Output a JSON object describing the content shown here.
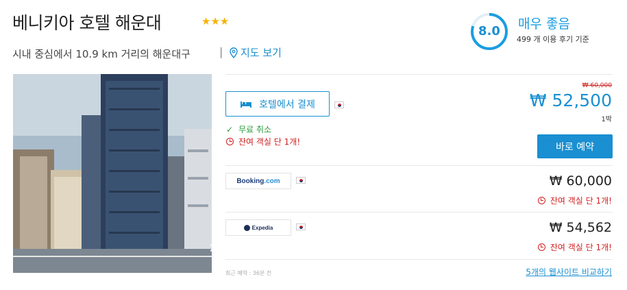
{
  "hotel": {
    "name": "베니키아 호텔 해운대",
    "stars": "★★★",
    "location": "시내 중심에서 10.9 km 거리의 해운대구",
    "location_separator": "|",
    "map_link": "지도 보기"
  },
  "rating": {
    "score": "8.0",
    "label": "매우 좋음",
    "reviews": "499 개 이용 후기 기준",
    "score_fraction": 0.8,
    "accent_color": "#1a9de1"
  },
  "photo": {
    "next_icon": "chevron-right-icon",
    "next_glyph": "›"
  },
  "offer": {
    "pay_button": "호텔에서 결제",
    "pay_icon": "bed-icon",
    "free_cancel_icon": "check-icon",
    "free_cancel_glyph": "✓",
    "free_cancel": "무료 취소",
    "rooms_left": "잔여 객실 단 1개!",
    "old_price": "₩ 60,000",
    "price": "₩ 52,500",
    "per_night": "1박",
    "book_button": "바로 예약",
    "price_color": "#1a8fd1"
  },
  "partners": [
    {
      "name_main": "Booking",
      "name_suffix": ".com",
      "price": "₩ 60,000",
      "rooms_left": "잔여 객실 단 1개!"
    },
    {
      "name_main": "Expedia",
      "price": "₩ 54,562",
      "rooms_left": "잔여 객실 단 1개!"
    }
  ],
  "footer": {
    "recent_booking": "최근 예약 : 36분 전",
    "compare_link": "5개의 웹사이트 비교하기"
  }
}
